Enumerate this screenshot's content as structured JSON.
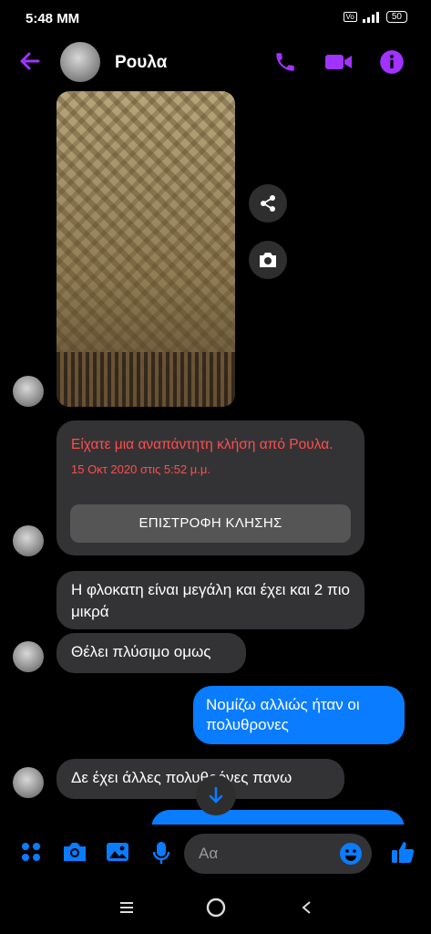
{
  "status": {
    "time": "5:48 MM",
    "battery": "50"
  },
  "header": {
    "contact_name": "Ρουλα",
    "accent": "#a033ff"
  },
  "missed_call": {
    "title": "Είχατε μια αναπάντητη κλήση από Ρουλα.",
    "date": "15 Οκτ 2020 στις 5:52 μ.μ.",
    "callback_label": "ΕΠΙΣΤΡΟΦΗ ΚΛΗΣΗΣ"
  },
  "messages": [
    {
      "from": "them",
      "text": "Η φλοκατη είναι μεγάλη και έχει και 2 πιο μικρά"
    },
    {
      "from": "them",
      "text": "Θέλει πλύσιμο ομως"
    },
    {
      "from": "me",
      "text": "Νομίζω αλλιώς ήταν οι πολυθρονες"
    },
    {
      "from": "them",
      "text": "Δε έχει άλλες πολυθρόνες πανω"
    }
  ],
  "composer": {
    "placeholder": "Αα",
    "accent": "#0a7cff"
  }
}
